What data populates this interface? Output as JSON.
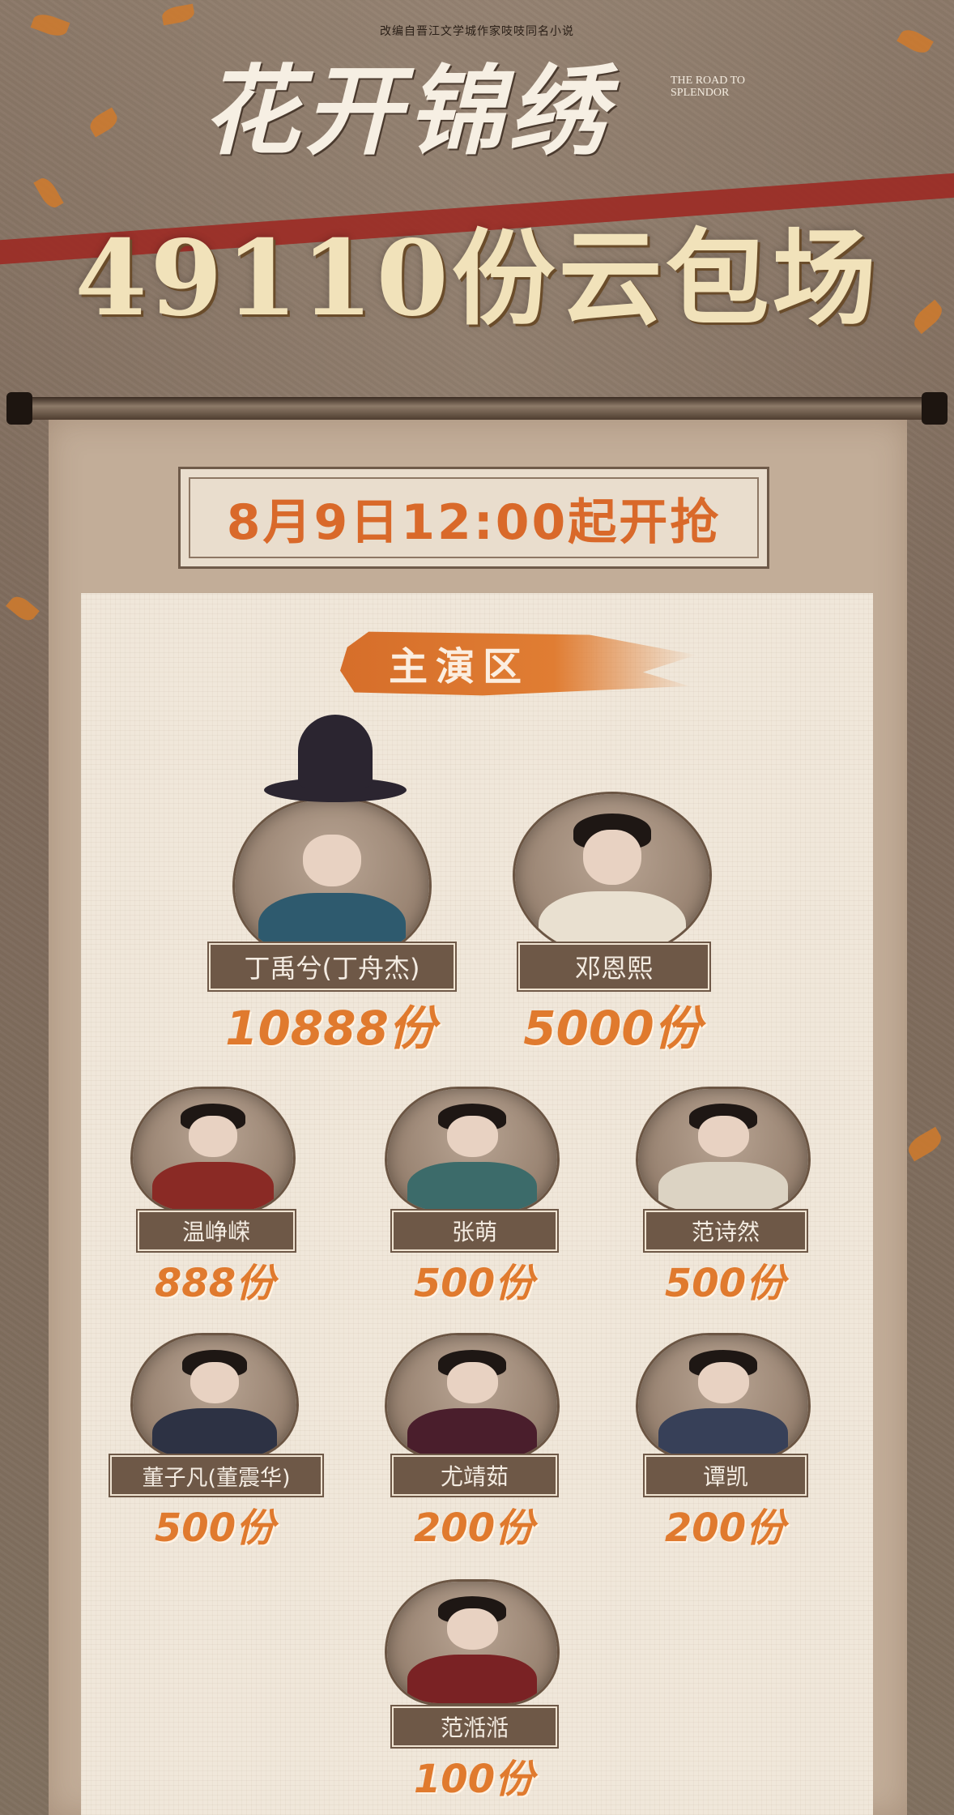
{
  "header": {
    "subtitle": "改编自晋江文学城作家吱吱同名小说",
    "logo": "花开锦绣",
    "logo_en": "THE ROAD TO SPLENDOR",
    "headline": "49110份云包场"
  },
  "date_banner": "8月9日12:00起开抢",
  "section_title": "主演区",
  "actors": [
    {
      "name": "丁禹兮(丁舟杰)",
      "count": "10888份",
      "outfit": "#2e5a6e"
    },
    {
      "name": "邓恩熙",
      "count": "5000份",
      "outfit": "#e9e0d0"
    },
    {
      "name": "温峥嵘",
      "count": "888份",
      "outfit": "#8a2a25"
    },
    {
      "name": "张萌",
      "count": "500份",
      "outfit": "#3c6b6a"
    },
    {
      "name": "范诗然",
      "count": "500份",
      "outfit": "#dcd3c3"
    },
    {
      "name": "董子凡(董震华)",
      "count": "500份",
      "outfit": "#2d3244"
    },
    {
      "name": "尤靖茹",
      "count": "200份",
      "outfit": "#4a1e2c"
    },
    {
      "name": "谭凯",
      "count": "200份",
      "outfit": "#374058"
    },
    {
      "name": "范湉湉",
      "count": "100份",
      "outfit": "#7a2224"
    }
  ],
  "colors": {
    "accent_orange": "#e07a2e",
    "plate_brown": "#6e5847",
    "ribbon_red": "#9c2a23"
  }
}
